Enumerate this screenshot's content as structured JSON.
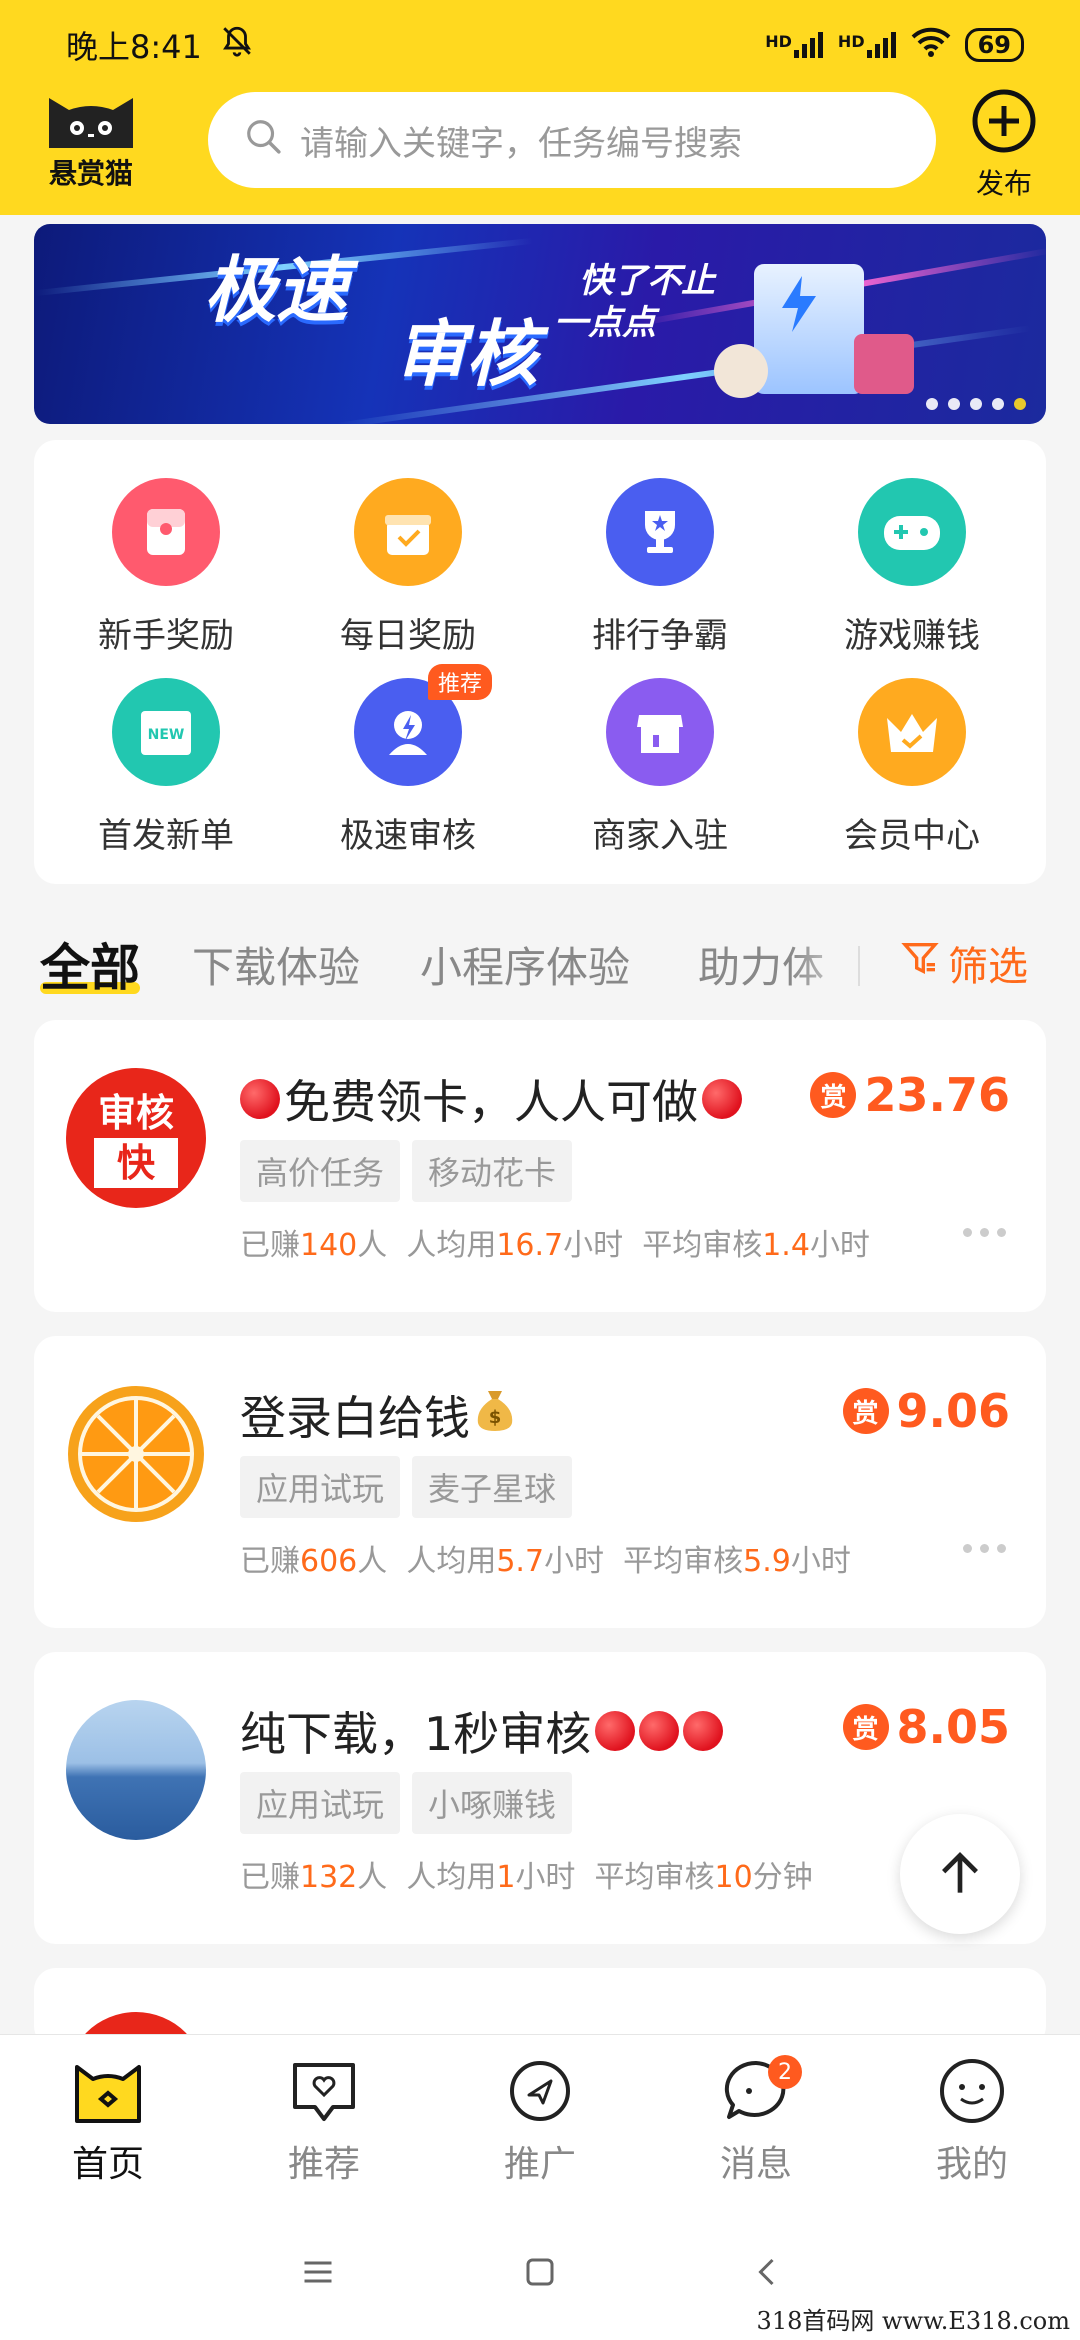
{
  "status_bar": {
    "time": "晚上8:41",
    "signal_label_1": "HD",
    "signal_label_2": "HD",
    "battery": "69"
  },
  "header": {
    "logo_text": "悬赏猫",
    "search_placeholder": "请输入关键字，任务编号搜索",
    "publish_label": "发布"
  },
  "banner": {
    "title_line1": "极速",
    "title_line2": "审核",
    "subtitle_line1": "快了不止",
    "subtitle_line2": "一点点",
    "active_dot_index": 4,
    "dot_count": 5
  },
  "grid": {
    "items": [
      {
        "label": "新手奖励",
        "icon": "red-envelope-icon",
        "color": "#ff5a6e"
      },
      {
        "label": "每日奖励",
        "icon": "gift-box-icon",
        "color": "#ffaa1f"
      },
      {
        "label": "排行争霸",
        "icon": "trophy-icon",
        "color": "#4a5ef0"
      },
      {
        "label": "游戏赚钱",
        "icon": "gamepad-icon",
        "color": "#22c7b0"
      },
      {
        "label": "首发新单",
        "icon": "new-badge-icon",
        "color": "#22c7b0"
      },
      {
        "label": "极速审核",
        "icon": "fast-review-icon",
        "color": "#4a5ef0",
        "badge": "推荐"
      },
      {
        "label": "商家入驻",
        "icon": "store-icon",
        "color": "#8a5cf0"
      },
      {
        "label": "会员中心",
        "icon": "crown-icon",
        "color": "#ffaa1f"
      }
    ]
  },
  "tabs": {
    "items": [
      "全部",
      "下载体验",
      "小程序体验",
      "助力体"
    ],
    "active_index": 0,
    "filter_label": "筛选"
  },
  "tasks": [
    {
      "title": "免费领卡，人人可做",
      "reward_badge": "赏",
      "reward": "23.76",
      "tags": [
        "高价任务",
        "移动花卡"
      ],
      "avatar_text_top": "审核",
      "avatar_text_bottom": "快",
      "meta": {
        "earned_prefix": "已赚",
        "earned": "140",
        "earned_suffix": "人",
        "avg_prefix": "人均用",
        "avg": "16.7",
        "avg_suffix": "小时",
        "review_prefix": "平均审核",
        "review": "1.4",
        "review_suffix": "小时"
      }
    },
    {
      "title": "登录白给钱",
      "reward_badge": "赏",
      "reward": "9.06",
      "tags": [
        "应用试玩",
        "麦子星球"
      ],
      "meta": {
        "earned_prefix": "已赚",
        "earned": "606",
        "earned_suffix": "人",
        "avg_prefix": "人均用",
        "avg": "5.7",
        "avg_suffix": "小时",
        "review_prefix": "平均审核",
        "review": "5.9",
        "review_suffix": "小时"
      }
    },
    {
      "title": "纯下载，1秒审核",
      "reward_badge": "赏",
      "reward": "8.05",
      "tags": [
        "应用试玩",
        "小啄赚钱"
      ],
      "meta": {
        "earned_prefix": "已赚",
        "earned": "132",
        "earned_suffix": "人",
        "avg_prefix": "人均用",
        "avg": "1",
        "avg_suffix": "小时",
        "review_prefix": "平均审核",
        "review": "10",
        "review_suffix": "分钟"
      }
    }
  ],
  "bottom_nav": {
    "items": [
      {
        "label": "首页",
        "icon": "cat-home-icon"
      },
      {
        "label": "推荐",
        "icon": "heart-bubble-icon"
      },
      {
        "label": "推广",
        "icon": "send-icon"
      },
      {
        "label": "消息",
        "icon": "message-icon",
        "badge": "2"
      },
      {
        "label": "我的",
        "icon": "smile-icon"
      }
    ],
    "active_index": 0
  },
  "watermark": "318首码网 www.E318.com",
  "colors": {
    "brand_yellow": "#ffd91f",
    "accent_orange": "#ff5a1f"
  }
}
